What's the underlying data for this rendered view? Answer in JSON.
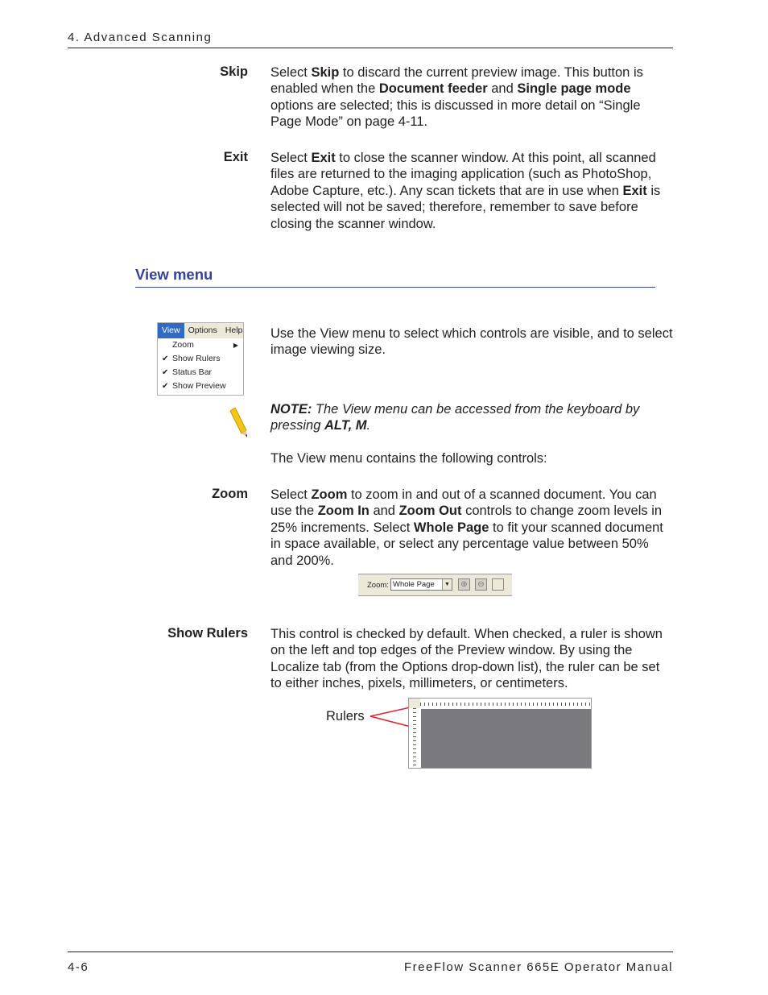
{
  "header": {
    "chapter": "4. Advanced Scanning"
  },
  "sections": [
    {
      "label": "Skip",
      "runs": [
        [
          "Select ",
          0
        ],
        [
          "Skip",
          1
        ],
        [
          " to discard the current preview image.  This button is enabled when the ",
          0
        ],
        [
          "Document feeder",
          1
        ],
        [
          " and ",
          0
        ],
        [
          "Single page mode",
          1
        ],
        [
          " options are selected; this is discussed in more detail on “Single Page Mode” on page 4-11.",
          0
        ]
      ]
    },
    {
      "label": "Exit",
      "runs": [
        [
          "Select ",
          0
        ],
        [
          "Exit",
          1
        ],
        [
          " to close the scanner window.  At this point, all scanned files are returned to the imaging application (such as PhotoShop, Adobe Capture, etc.).  Any scan tickets that are in use when ",
          0
        ],
        [
          "Exit",
          1
        ],
        [
          " is selected will not be saved; therefore, remember to save before closing the scanner window.",
          0
        ]
      ]
    }
  ],
  "view_menu": {
    "heading": "View menu",
    "menu_image": {
      "bar": [
        "View",
        "Options",
        "Help"
      ],
      "items": [
        {
          "label": "Zoom",
          "checked": false,
          "submenu": true
        },
        {
          "label": "Show Rulers",
          "checked": true
        },
        {
          "label": "Status Bar",
          "checked": true
        },
        {
          "label": "Show Preview",
          "checked": true
        }
      ]
    },
    "intro": "Use the View menu to select which controls are visible, and to select image viewing size.",
    "note_runs": [
      [
        "NOTE:",
        1
      ],
      [
        " The View menu can be accessed from the keyboard by pressing ",
        0
      ],
      [
        "ALT, M",
        1
      ],
      [
        ".",
        0
      ]
    ],
    "contains": "The View menu contains the following controls:",
    "zoom": {
      "label": "Zoom",
      "runs": [
        [
          "Select ",
          0
        ],
        [
          "Zoom",
          1
        ],
        [
          " to zoom in and out of a scanned document.  You can use the ",
          0
        ],
        [
          "Zoom In",
          1
        ],
        [
          " and ",
          0
        ],
        [
          "Zoom Out",
          1
        ],
        [
          " controls to change zoom levels in 25% increments.  Select ",
          0
        ],
        [
          "Whole Page",
          1
        ],
        [
          " to fit your scanned document in space available, or select any percentage value between 50% and 200%.",
          0
        ]
      ]
    },
    "zoom_toolbar": {
      "label": "Zoom:",
      "value": "Whole Page"
    },
    "show_rulers": {
      "label": "Show Rulers",
      "runs": [
        [
          "This control is checked by default.  When checked, a ruler is shown on the left and top edges of the Preview window.  By using the Localize tab (from the Options drop-down list), the ruler can be set to either inches, pixels, millimeters, or centimeters.",
          0
        ]
      ]
    },
    "rulers_callout": "Rulers"
  },
  "footer": {
    "page": "4-6",
    "title": "FreeFlow Scanner 665E Operator Manual"
  },
  "colors": {
    "heading": "#3440a4",
    "menu_active": "#316ac5",
    "callout": "#e8202a",
    "preview_bg": "#7a797e"
  }
}
